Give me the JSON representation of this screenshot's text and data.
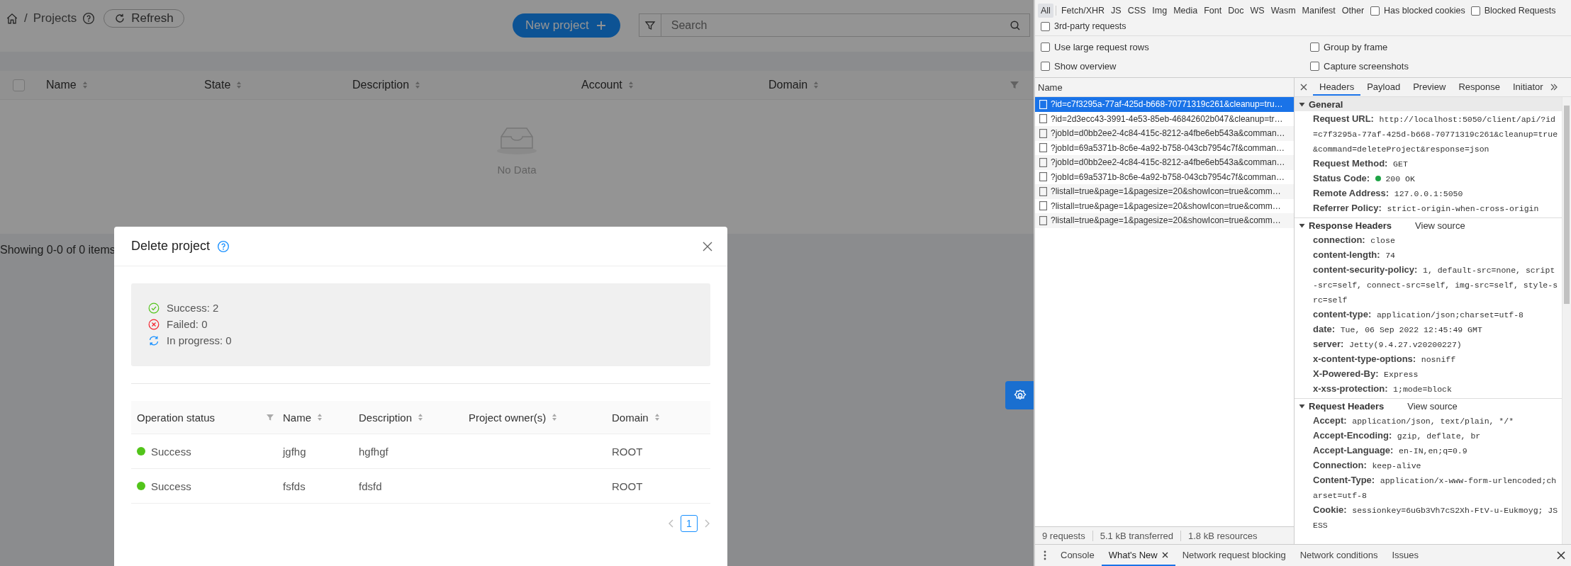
{
  "breadcrumb": {
    "current": "Projects",
    "separator": "/"
  },
  "toolbar": {
    "refresh_button": "Refresh",
    "new_project_button": "New project",
    "search": {
      "placeholder": "Search"
    }
  },
  "projects_table": {
    "select_all_checked": false,
    "columns": [
      "Name",
      "State",
      "Description",
      "Account",
      "Domain"
    ],
    "empty_text": "No Data",
    "footer": "Showing 0-0 of 0 items"
  },
  "dialog": {
    "title": "Delete project",
    "summary": [
      {
        "kind": "success",
        "text": "Success: 2"
      },
      {
        "kind": "failed",
        "text": "Failed: 0"
      },
      {
        "kind": "progress",
        "text": "In progress: 0"
      }
    ],
    "columns": [
      {
        "label": "Operation status",
        "kind": "filter"
      },
      {
        "label": "Name",
        "kind": "sort"
      },
      {
        "label": "Description",
        "kind": "sort"
      },
      {
        "label": "Project owner(s)",
        "kind": "sort"
      },
      {
        "label": "Domain",
        "kind": "sort"
      }
    ],
    "rows": [
      {
        "status": "Success",
        "color": "#52c41a",
        "name": "jgfhg",
        "description": "hgfhgf",
        "domain": "ROOT"
      },
      {
        "status": "Success",
        "color": "#52c41a",
        "name": "fsfds",
        "description": "fdsfd",
        "domain": "ROOT"
      }
    ],
    "pages": [
      {
        "label": "1",
        "selected": true
      }
    ]
  },
  "devtools": {
    "type_filters": [
      {
        "label": "All",
        "selected": true
      },
      {
        "label": "Fetch/XHR",
        "selected": false
      },
      {
        "label": "JS",
        "selected": false
      },
      {
        "label": "CSS",
        "selected": false
      },
      {
        "label": "Img",
        "selected": false
      },
      {
        "label": "Media",
        "selected": false
      },
      {
        "label": "Font",
        "selected": false
      },
      {
        "label": "Doc",
        "selected": false
      },
      {
        "label": "WS",
        "selected": false
      },
      {
        "label": "Wasm",
        "selected": false
      },
      {
        "label": "Manifest",
        "selected": false
      },
      {
        "label": "Other",
        "selected": false
      }
    ],
    "filter_checkboxes": [
      {
        "label": "Has blocked cookies",
        "checked": false
      },
      {
        "label": "Blocked Requests",
        "checked": false
      },
      {
        "label": "3rd-party requests",
        "checked": false
      }
    ],
    "settings": [
      {
        "label": "Use large request rows",
        "checked": false
      },
      {
        "label": "Group by frame",
        "checked": false
      },
      {
        "label": "Show overview",
        "checked": false
      },
      {
        "label": "Capture screenshots",
        "checked": false
      }
    ],
    "requests_column": "Name",
    "requests": [
      {
        "name": "?id=c7f3295a-77af-425d-b668-70771319c261&cleanup=tru…",
        "selected": true
      },
      {
        "name": "?id=2d3ecc43-3991-4e53-85eb-46842602b047&cleanup=tr…",
        "selected": false
      },
      {
        "name": "?jobId=d0bb2ee2-4c84-415c-8212-a4fbe6eb543a&comman…",
        "selected": false
      },
      {
        "name": "?jobId=69a5371b-8c6e-4a92-b758-043cb7954c7f&comman…",
        "selected": false
      },
      {
        "name": "?jobId=d0bb2ee2-4c84-415c-8212-a4fbe6eb543a&comman…",
        "selected": false
      },
      {
        "name": "?jobId=69a5371b-8c6e-4a92-b758-043cb7954c7f&comman…",
        "selected": false
      },
      {
        "name": "?listall=true&page=1&pagesize=20&showIcon=true&comm…",
        "selected": false
      },
      {
        "name": "?listall=true&page=1&pagesize=20&showIcon=true&comm…",
        "selected": false
      },
      {
        "name": "?listall=true&page=1&pagesize=20&showIcon=true&comm…",
        "selected": false
      }
    ],
    "status_bar": [
      "9 requests",
      "5.1 kB transferred",
      "1.8 kB resources"
    ],
    "detail_tabs": [
      {
        "label": "Headers",
        "selected": true
      },
      {
        "label": "Payload",
        "selected": false
      },
      {
        "label": "Preview",
        "selected": false
      },
      {
        "label": "Response",
        "selected": false
      },
      {
        "label": "Initiator",
        "selected": false
      }
    ],
    "sections": [
      {
        "title": "General",
        "expanded": true,
        "headers": [
          {
            "name": "Request URL:",
            "value": "http://localhost:5050/client/api/?id=c7f3295a-77af-425d-b668-70771319c261&cleanup=true&command=deleteProject&response=json"
          },
          {
            "name": "Request Method:",
            "value": "GET"
          },
          {
            "name": "Status Code:",
            "value": "200 OK",
            "color": "#1ea446"
          },
          {
            "name": "Remote Address:",
            "value": "127.0.0.1:5050"
          },
          {
            "name": "Referrer Policy:",
            "value": "strict-origin-when-cross-origin"
          }
        ]
      },
      {
        "title": "Response Headers",
        "link": "View source",
        "expanded": true,
        "headers": [
          {
            "name": "connection:",
            "value": "close"
          },
          {
            "name": "content-length:",
            "value": "74"
          },
          {
            "name": "content-security-policy:",
            "value": "1, default-src=none, script-src=self, connect-src=self, img-src=self, style-src=self"
          },
          {
            "name": "content-type:",
            "value": "application/json;charset=utf-8"
          },
          {
            "name": "date:",
            "value": "Tue, 06 Sep 2022 12:45:49 GMT"
          },
          {
            "name": "server:",
            "value": "Jetty(9.4.27.v20200227)"
          },
          {
            "name": "x-content-type-options:",
            "value": "nosniff"
          },
          {
            "name": "X-Powered-By:",
            "value": "Express"
          },
          {
            "name": "x-xss-protection:",
            "value": "1;mode=block"
          }
        ]
      },
      {
        "title": "Request Headers",
        "link": "View source",
        "expanded": true,
        "headers": [
          {
            "name": "Accept:",
            "value": "application/json, text/plain, */*"
          },
          {
            "name": "Accept-Encoding:",
            "value": "gzip, deflate, br"
          },
          {
            "name": "Accept-Language:",
            "value": "en-IN,en;q=0.9"
          },
          {
            "name": "Connection:",
            "value": "keep-alive"
          },
          {
            "name": "Content-Type:",
            "value": "application/x-www-form-urlencoded;charset=utf-8"
          },
          {
            "name": "Cookie:",
            "value": "sessionkey=6uGb3Vh7cS2Xh-FtV-u-Eukmoyg; JSESS"
          }
        ]
      }
    ],
    "drawer_tabs": [
      {
        "label": "Console",
        "selected": false,
        "closable": false
      },
      {
        "label": "What's New",
        "selected": true,
        "closable": true
      },
      {
        "label": "Network request blocking",
        "selected": false,
        "closable": false
      },
      {
        "label": "Network conditions",
        "selected": false,
        "closable": false
      },
      {
        "label": "Issues",
        "selected": false,
        "closable": false
      }
    ]
  }
}
